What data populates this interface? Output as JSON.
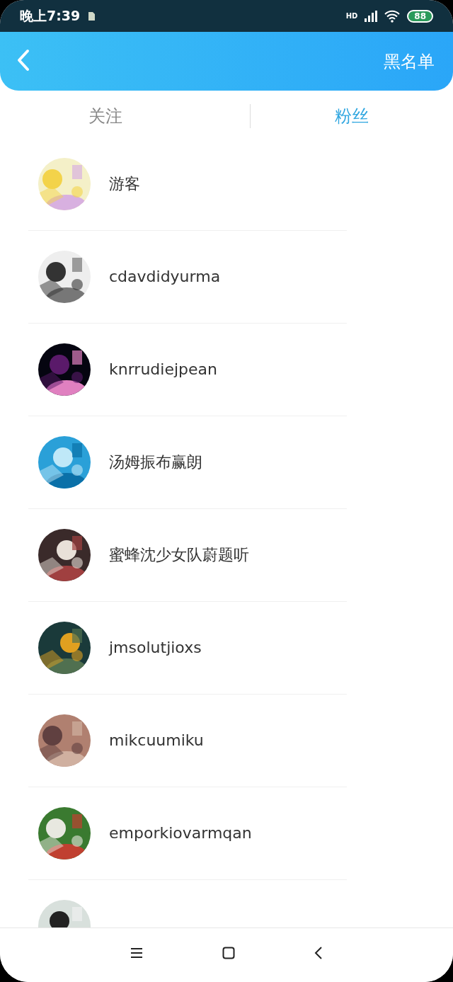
{
  "status_bar": {
    "time": "晚上7:39",
    "network": "HD",
    "battery": "88"
  },
  "header": {
    "action": "黑名单"
  },
  "tabs": [
    {
      "label": "关注",
      "selected": false
    },
    {
      "label": "粉丝",
      "selected": true
    }
  ],
  "fans": [
    {
      "name": "游客",
      "avatar": {
        "kind": "picture"
      }
    },
    {
      "name": "cdavdidyurma",
      "avatar": {
        "kind": "picture"
      }
    },
    {
      "name": "knrrudiejpean",
      "avatar": {
        "kind": "picture"
      }
    },
    {
      "name": "汤姆振布赢朗",
      "avatar": {
        "kind": "picture"
      }
    },
    {
      "name": "蜜蜂沈少女队蔚题听",
      "avatar": {
        "kind": "picture"
      }
    },
    {
      "name": "jmsolutjioxs",
      "avatar": {
        "kind": "picture"
      }
    },
    {
      "name": "mikcuumiku",
      "avatar": {
        "kind": "picture"
      }
    },
    {
      "name": "emporkiovarmqan",
      "avatar": {
        "kind": "picture"
      }
    },
    {
      "avatar": {
        "kind": "picture"
      }
    }
  ]
}
